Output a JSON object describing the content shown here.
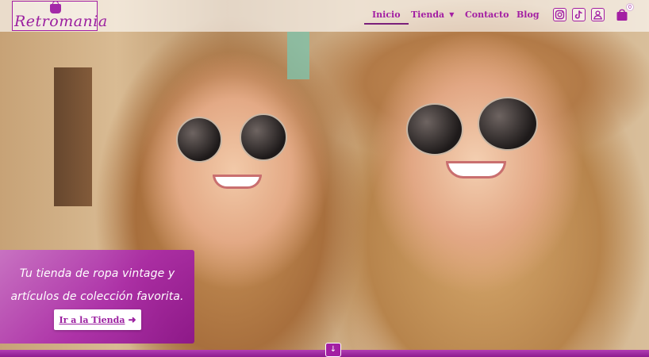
{
  "brand": {
    "name": "Retromania",
    "primary_color": "#a31fa3"
  },
  "nav": {
    "items": [
      {
        "label": "Inicio",
        "active": true
      },
      {
        "label": "Tienda",
        "has_dropdown": true
      },
      {
        "label": "Contacto"
      },
      {
        "label": "Blog"
      }
    ],
    "icons": [
      "instagram-icon",
      "tiktok-icon",
      "user-account-icon",
      "shopping-bag-icon"
    ],
    "cart_count": "0"
  },
  "hero": {
    "tagline": "Tu tienda de ropa vintage y artículos de colección favorita.",
    "cta_label": "Ir a la Tienda"
  }
}
